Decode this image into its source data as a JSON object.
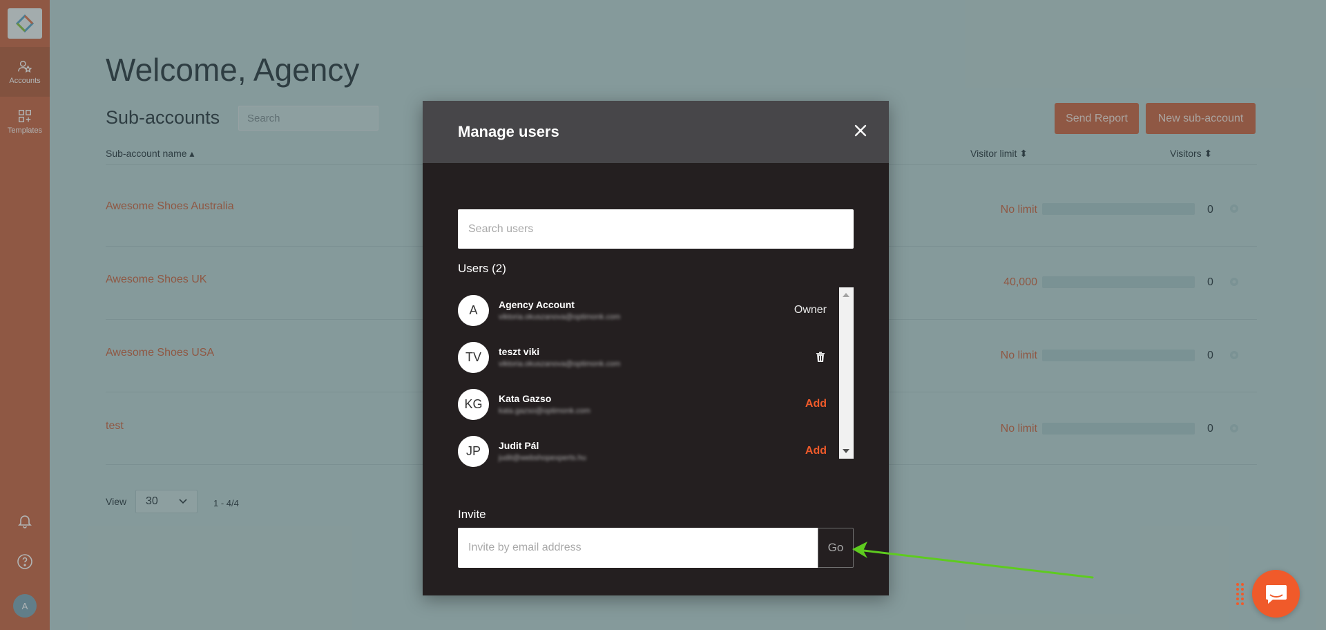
{
  "sidebar": {
    "items": [
      {
        "label": "Accounts",
        "icon": "accounts-icon"
      },
      {
        "label": "Templates",
        "icon": "templates-icon"
      }
    ],
    "bottom": {
      "avatar_initial": "A"
    }
  },
  "page": {
    "title": "Welcome, Agency",
    "section_title": "Sub-accounts",
    "search_placeholder": "Search",
    "send_report_label": "Send Report",
    "new_subaccount_label": "New sub-account"
  },
  "table": {
    "columns": {
      "name": "Sub-account name ▴",
      "visitor_limit": "Visitor limit ⬍",
      "visitors": "Visitors ⬍"
    },
    "rows": [
      {
        "name": "Awesome Shoes Australia",
        "limit": "No limit",
        "usage": 0,
        "visitors": "0"
      },
      {
        "name": "Awesome Shoes UK",
        "limit": "40,000",
        "usage": 0,
        "visitors": "0"
      },
      {
        "name": "Awesome Shoes USA",
        "limit": "No limit",
        "usage": 0,
        "visitors": "0"
      },
      {
        "name": "test",
        "limit": "No limit",
        "usage": 0,
        "visitors": "0"
      }
    ]
  },
  "pagination": {
    "view_label": "View",
    "per_page": "30",
    "range": "1 - 4/4"
  },
  "modal": {
    "title": "Manage users",
    "search_placeholder": "Search users",
    "users_label": "Users (2)",
    "users": [
      {
        "initials": "A",
        "name": "Agency Account",
        "email": "viktoria.okuszanova@optimonk.com",
        "action": "Owner"
      },
      {
        "initials": "TV",
        "name": "teszt viki",
        "email": "viktoria.okuszanova@optimonk.com",
        "action": "delete"
      },
      {
        "initials": "KG",
        "name": "Kata Gazso",
        "email": "kata.gazso@optimonk.com",
        "action": "Add"
      },
      {
        "initials": "JP",
        "name": "Judit Pál",
        "email": "judit@webshopexperts.hu",
        "action": "Add"
      }
    ],
    "invite_label": "Invite",
    "invite_placeholder": "Invite by email address",
    "go_label": "Go"
  },
  "colors": {
    "accent": "#c86a47",
    "add_action": "#f05a2a",
    "modal_bg": "#241f20",
    "modal_header": "#474649",
    "annotation_arrow": "#5ecb1f"
  }
}
